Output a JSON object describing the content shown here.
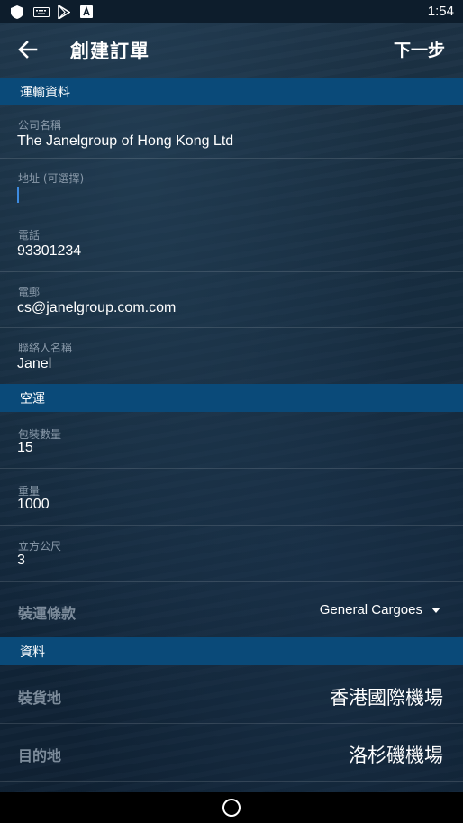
{
  "status_bar": {
    "time": "1:54",
    "icons": [
      "shield-icon",
      "keyboard-icon",
      "play-store-icon",
      "a-icon"
    ]
  },
  "appbar": {
    "title": "創建訂單",
    "next_label": "下一步"
  },
  "sections": {
    "transport": "運輸資料",
    "air": "空運",
    "info": "資料"
  },
  "transport_fields": {
    "company": {
      "label": "公司名稱",
      "value": "The Janelgroup of Hong Kong Ltd"
    },
    "address": {
      "label": "地址 (可選擇)",
      "value": ""
    },
    "phone": {
      "label": "電話",
      "value": "93301234"
    },
    "email": {
      "label": "電郵",
      "value": "cs@janelgroup.com.com"
    },
    "contact": {
      "label": "聯絡人名稱",
      "value": "Janel"
    }
  },
  "air_fields": {
    "packages": {
      "label": "包裝數量",
      "value": "15"
    },
    "weight": {
      "label": "重量",
      "value": "1000"
    },
    "cubic": {
      "label": "立方公尺",
      "value": "3"
    },
    "terms": {
      "label": "裝運條款",
      "value": "General Cargoes"
    }
  },
  "info_fields": {
    "origin": {
      "label": "裝貨地",
      "value": "香港國際機場"
    },
    "destination": {
      "label": "目的地",
      "value": "洛杉磯機場"
    }
  }
}
